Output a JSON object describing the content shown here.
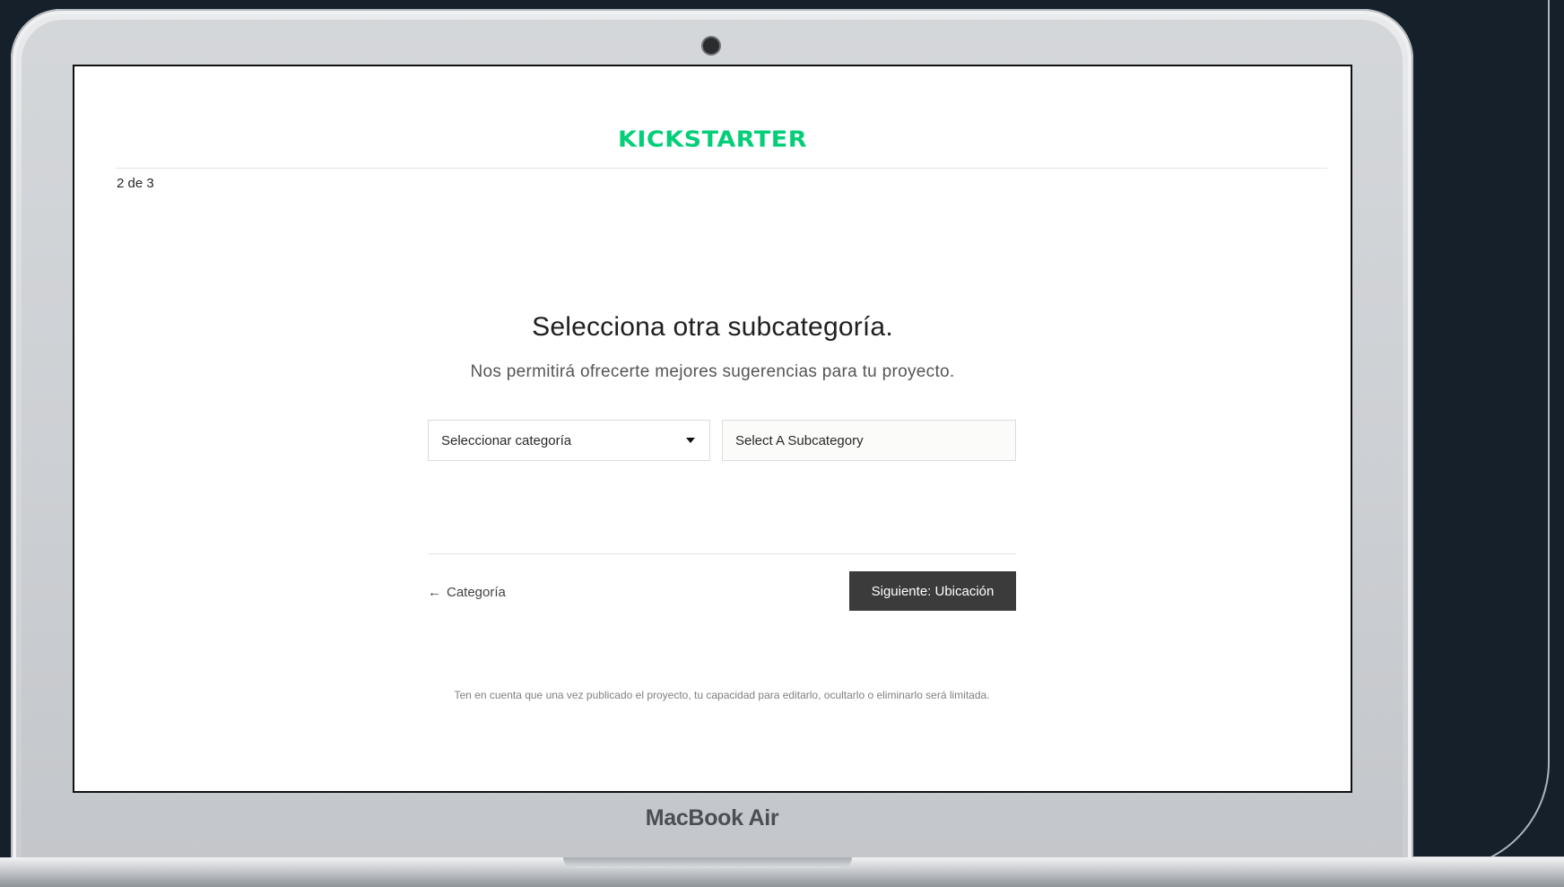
{
  "device": {
    "brand_label": "MacBook Air"
  },
  "header": {
    "logo_text": "KICKSTARTER",
    "step_indicator": "2 de 3"
  },
  "main": {
    "title": "Selecciona otra subcategoría.",
    "subtitle": "Nos permitirá ofrecerte mejores sugerencias para tu proyecto.",
    "category_select": {
      "value": "Seleccionar categoría"
    },
    "subcategory_select": {
      "value": "Select A Subcategory"
    }
  },
  "navigation": {
    "back_arrow": "←",
    "back_label": "Categoría",
    "next_label": "Siguiente: Ubicación"
  },
  "footer": {
    "disclaimer": "Ten en cuenta que una vez publicado el proyecto, tu capacidad para editarlo, ocultarlo o eliminarlo será limitada."
  },
  "colors": {
    "brand_green": "#05ce78",
    "button_dark": "#3b3b3b",
    "page_background": "#15202b"
  }
}
